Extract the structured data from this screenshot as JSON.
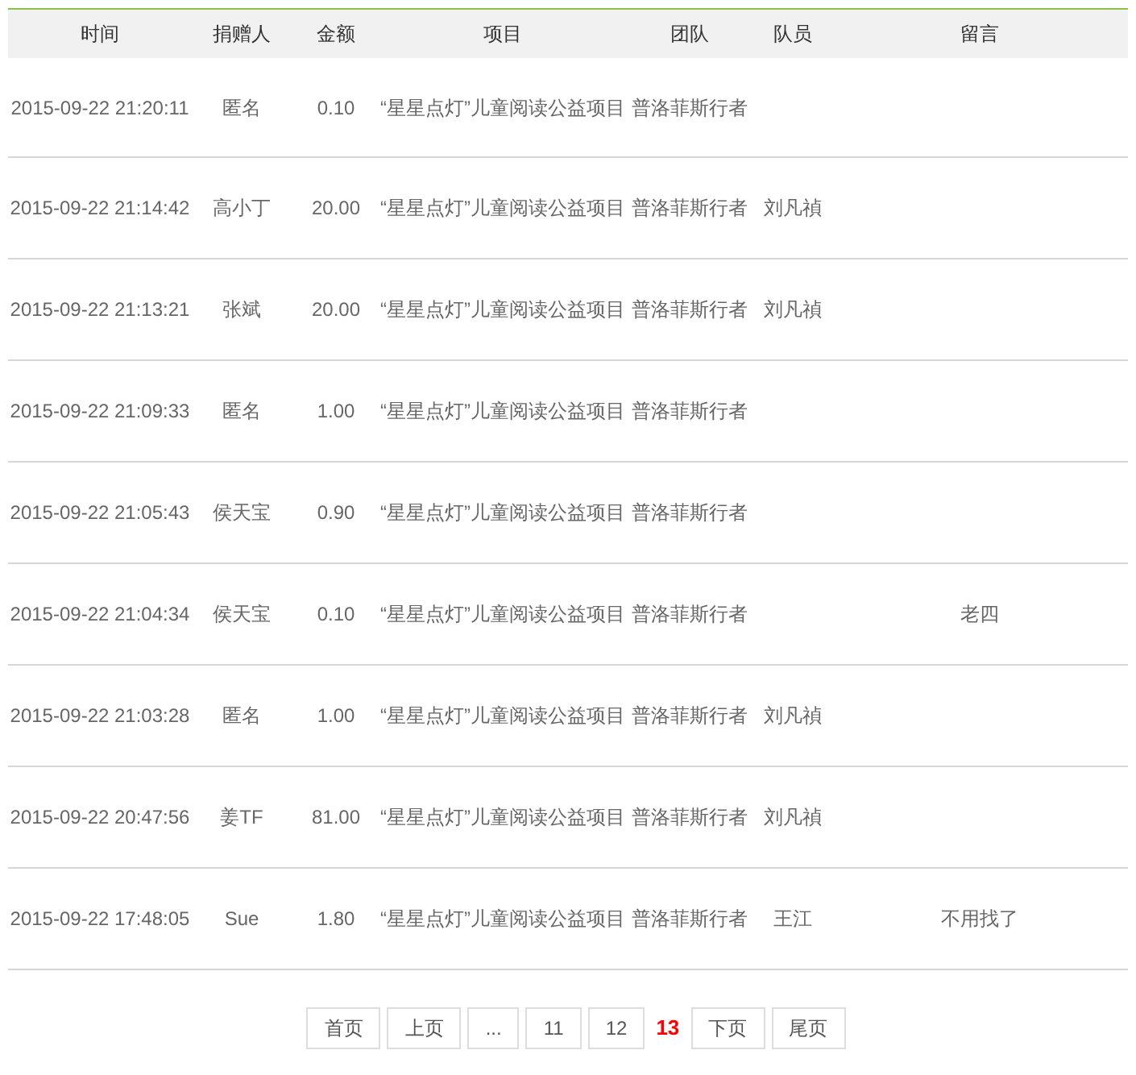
{
  "table": {
    "columns": [
      "时间",
      "捐赠人",
      "金额",
      "项目",
      "团队",
      "队员",
      "留言"
    ],
    "rows": [
      [
        "2015-09-22 21:20:11",
        "匿名",
        "0.10",
        "“星星点灯”儿童阅读公益项目",
        "普洛菲斯行者",
        "",
        ""
      ],
      [
        "2015-09-22 21:14:42",
        "高小丁",
        "20.00",
        "“星星点灯”儿童阅读公益项目",
        "普洛菲斯行者",
        "刘凡禎",
        ""
      ],
      [
        "2015-09-22 21:13:21",
        "张斌",
        "20.00",
        "“星星点灯”儿童阅读公益项目",
        "普洛菲斯行者",
        "刘凡禎",
        ""
      ],
      [
        "2015-09-22 21:09:33",
        "匿名",
        "1.00",
        "“星星点灯”儿童阅读公益项目",
        "普洛菲斯行者",
        "",
        ""
      ],
      [
        "2015-09-22 21:05:43",
        "侯天宝",
        "0.90",
        "“星星点灯”儿童阅读公益项目",
        "普洛菲斯行者",
        "",
        ""
      ],
      [
        "2015-09-22 21:04:34",
        "侯天宝",
        "0.10",
        "“星星点灯”儿童阅读公益项目",
        "普洛菲斯行者",
        "",
        "老四"
      ],
      [
        "2015-09-22 21:03:28",
        "匿名",
        "1.00",
        "“星星点灯”儿童阅读公益项目",
        "普洛菲斯行者",
        "刘凡禎",
        ""
      ],
      [
        "2015-09-22 20:47:56",
        "姜TF",
        "81.00",
        "“星星点灯”儿童阅读公益项目",
        "普洛菲斯行者",
        "刘凡禎",
        ""
      ],
      [
        "2015-09-22 17:48:05",
        "Sue",
        "1.80",
        "“星星点灯”儿童阅读公益项目",
        "普洛菲斯行者",
        "王江",
        "不用找了"
      ]
    ]
  },
  "pagination": [
    {
      "label": "首页",
      "selected": false
    },
    {
      "label": "上页",
      "selected": false
    },
    {
      "label": "...",
      "selected": false
    },
    {
      "label": "11",
      "selected": false
    },
    {
      "label": "12",
      "selected": false
    },
    {
      "label": "13",
      "selected": true
    },
    {
      "label": "下页",
      "selected": false
    },
    {
      "label": "尾页",
      "selected": false
    }
  ]
}
